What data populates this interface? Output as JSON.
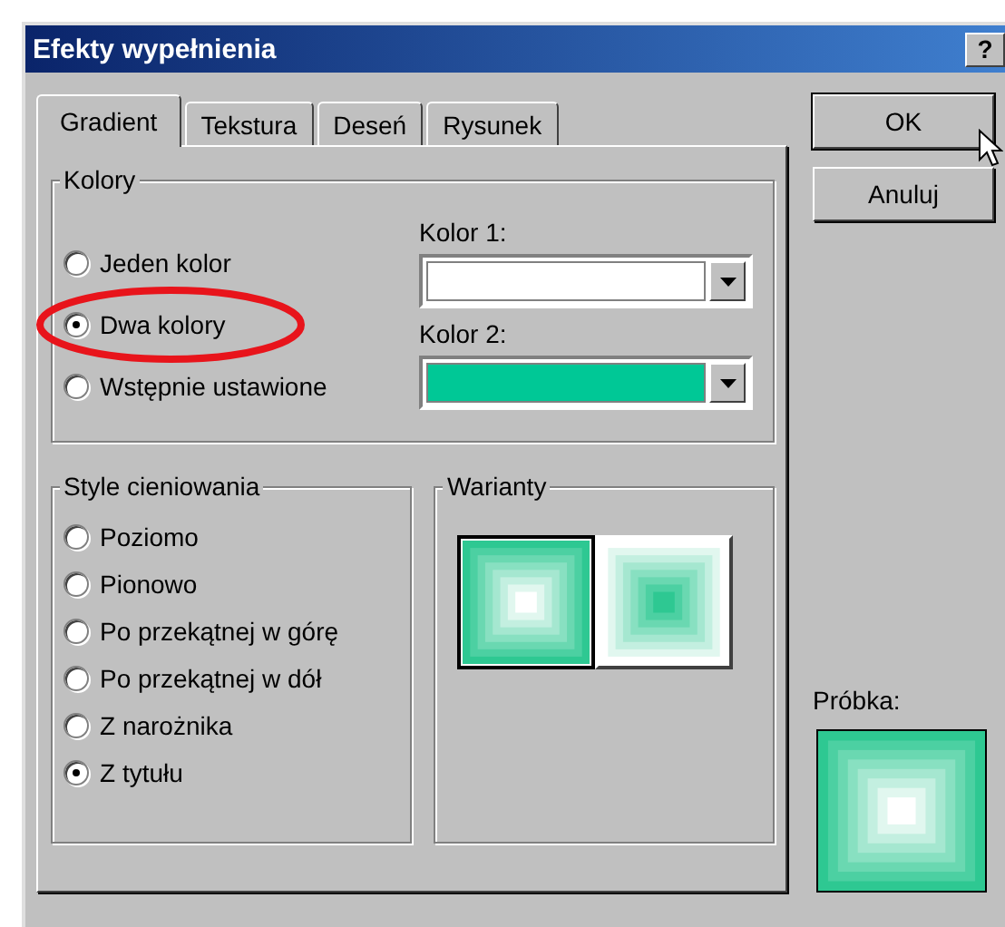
{
  "window": {
    "title": "Efekty wypełnienia",
    "title_buttons": [
      "?"
    ]
  },
  "tabs": [
    {
      "label": "Gradient",
      "selected": true
    },
    {
      "label": "Tekstura",
      "selected": false
    },
    {
      "label": "Deseń",
      "selected": false
    },
    {
      "label": "Rysunek",
      "selected": false
    }
  ],
  "colors_group": {
    "title": "Kolory",
    "options": [
      {
        "label": "Jeden kolor",
        "selected": false
      },
      {
        "label": "Dwa kolory",
        "selected": true
      },
      {
        "label": "Wstępnie ustawione",
        "selected": false
      }
    ],
    "pickers": [
      {
        "label": "Kolor 1:",
        "color": "#ffffff"
      },
      {
        "label": "Kolor 2:",
        "color": "#00c896"
      }
    ],
    "highlight": {
      "kind": "ellipse"
    }
  },
  "shading_group": {
    "title": "Style cieniowania",
    "options": [
      {
        "label": "Poziomo",
        "selected": false
      },
      {
        "label": "Pionowo",
        "selected": false
      },
      {
        "label": "Po przekątnej w górę",
        "selected": false
      },
      {
        "label": "Po przekątnej w dół",
        "selected": false
      },
      {
        "label": "Z narożnika",
        "selected": false
      },
      {
        "label": "Z tytułu",
        "selected": true
      }
    ]
  },
  "variants_group": {
    "title": "Warianty",
    "variants": [
      {
        "kind": "light-center",
        "selected": true
      },
      {
        "kind": "dark-center",
        "selected": false
      }
    ]
  },
  "buttons": [
    {
      "label": "OK",
      "hovered": true
    },
    {
      "label": "Anuluj",
      "hovered": false
    }
  ],
  "sample": {
    "label": "Próbka:",
    "kind": "light-center"
  }
}
